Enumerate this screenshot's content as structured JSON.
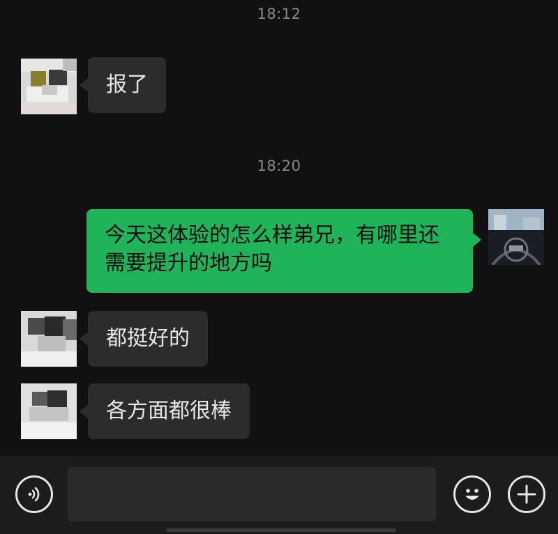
{
  "chat": {
    "timestamps": [
      "18:12",
      "18:20"
    ],
    "messages": [
      {
        "sender": "contact",
        "text": "报了"
      },
      {
        "sender": "me",
        "text": "今天这体验的怎么样弟兄，有哪里还需要提升的地方吗"
      },
      {
        "sender": "contact",
        "text": "都挺好的"
      },
      {
        "sender": "contact",
        "text": "各方面都很棒"
      }
    ]
  },
  "input_bar": {
    "message_value": "",
    "icons": [
      "voice-icon",
      "emoji-icon",
      "plus-icon"
    ]
  },
  "colors": {
    "background": "#111111",
    "incoming_bubble": "#2c2c2c",
    "outgoing_bubble": "#1fb35a",
    "bottom_bar": "#1c1c1c"
  }
}
